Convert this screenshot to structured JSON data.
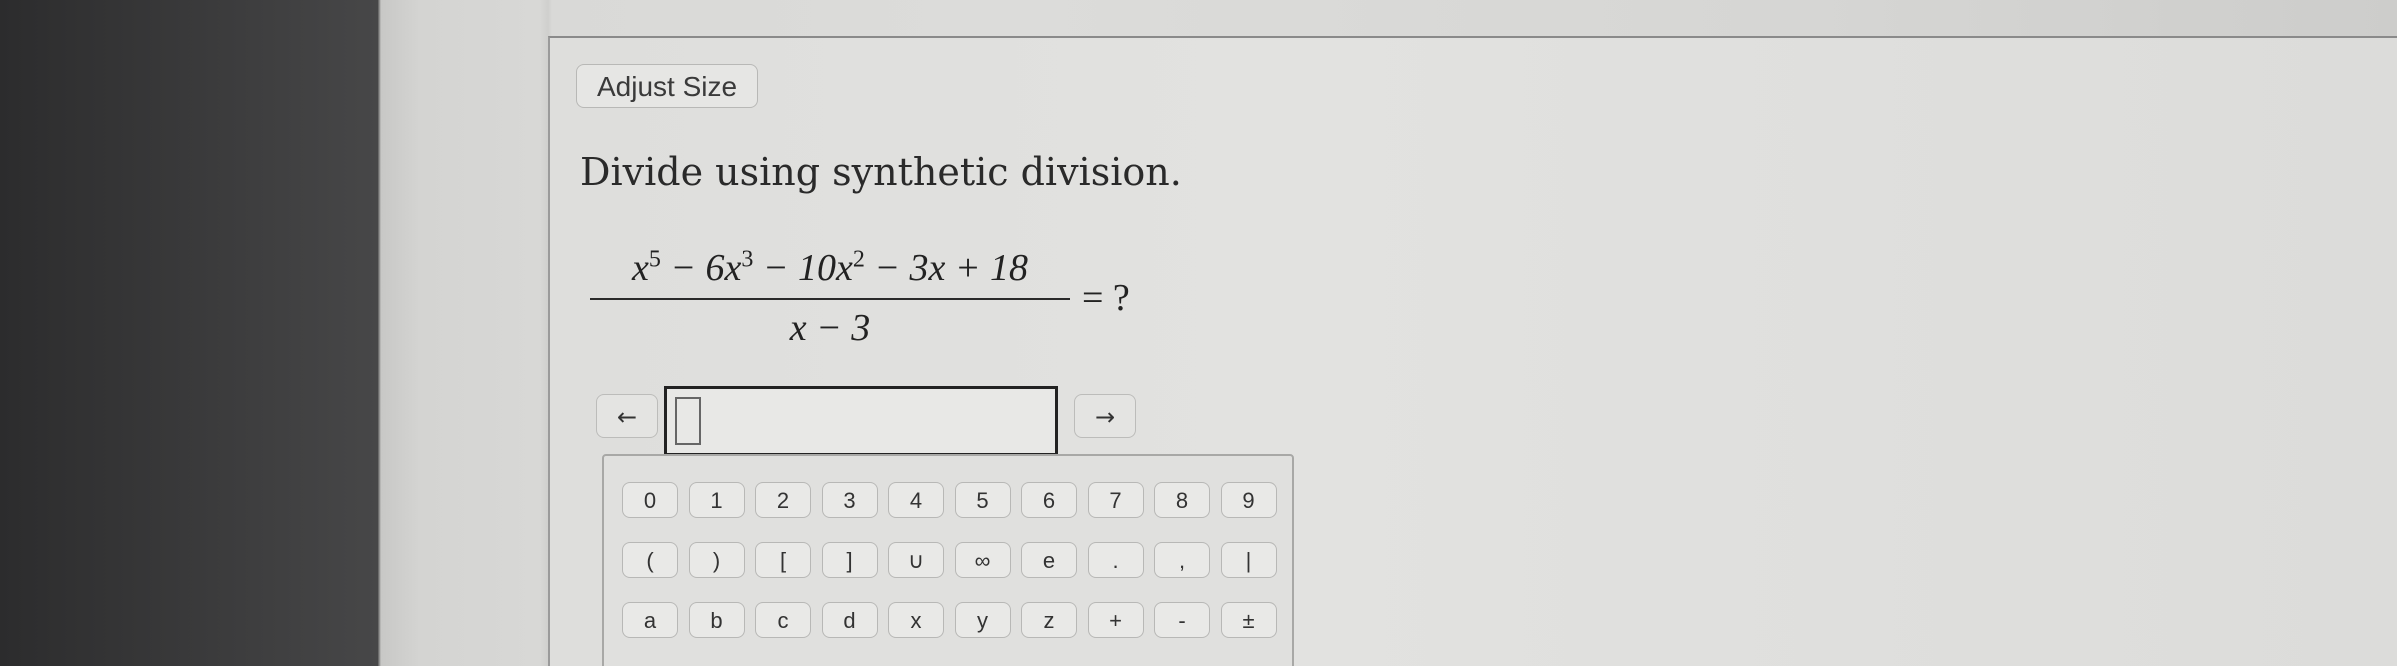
{
  "toolbar": {
    "adjust_size_label": "Adjust Size"
  },
  "question": {
    "instruction": "Divide using synthetic division.",
    "numerator": {
      "t1": "x",
      "e1": "5",
      "t2": " − 6x",
      "e2": "3",
      "t3": " − 10x",
      "e3": "2",
      "t4": " − 3x + 18"
    },
    "denominator": "x − 3",
    "equals": "=  ?"
  },
  "answer": {
    "left_arrow": "←",
    "right_arrow": "→",
    "value": ""
  },
  "keypad": {
    "row1": [
      "0",
      "1",
      "2",
      "3",
      "4",
      "5",
      "6",
      "7",
      "8",
      "9"
    ],
    "row2": [
      "(",
      ")",
      "[",
      "]",
      "∪",
      "∞",
      "e",
      ".",
      ",",
      "|"
    ],
    "row3": [
      "a",
      "b",
      "c",
      "d",
      "x",
      "y",
      "z",
      "+",
      "-",
      "±"
    ]
  }
}
